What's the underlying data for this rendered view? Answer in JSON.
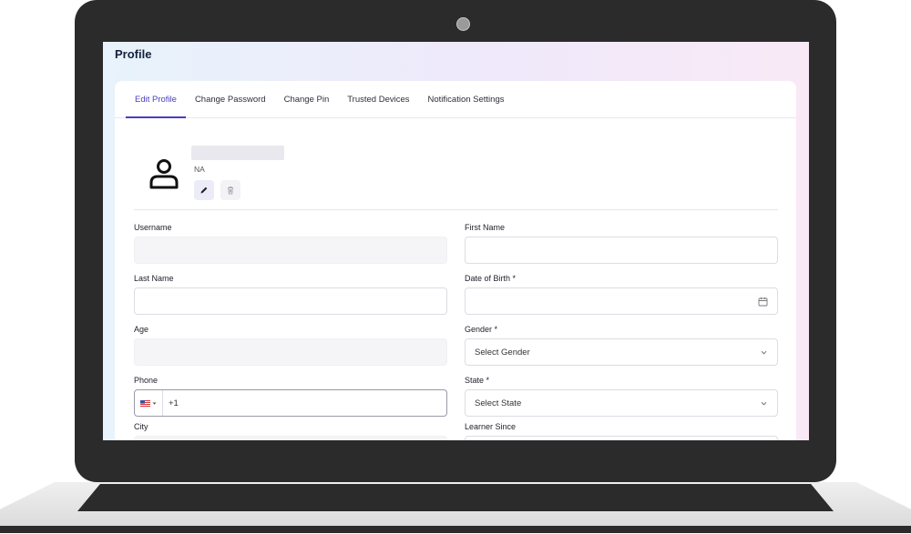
{
  "page": {
    "title": "Profile"
  },
  "tabs": [
    {
      "label": "Edit Profile",
      "active": true
    },
    {
      "label": "Change Password",
      "active": false
    },
    {
      "label": "Change Pin",
      "active": false
    },
    {
      "label": "Trusted Devices",
      "active": false
    },
    {
      "label": "Notification Settings",
      "active": false
    }
  ],
  "profile": {
    "role": "NA",
    "avatar_icon": "user-icon",
    "edit_icon": "pencil-icon",
    "delete_icon": "trash-icon"
  },
  "form": {
    "username": {
      "label": "Username",
      "value": ""
    },
    "first_name": {
      "label": "First Name",
      "value": ""
    },
    "last_name": {
      "label": "Last Name",
      "value": ""
    },
    "dob": {
      "label": "Date of Birth *",
      "value": "",
      "icon": "calendar-icon"
    },
    "age": {
      "label": "Age",
      "value": ""
    },
    "gender": {
      "label": "Gender *",
      "value": "Select Gender",
      "icon": "chevron-down-icon"
    },
    "phone": {
      "label": "Phone",
      "dial_code": "+1",
      "value": "",
      "flag_icon": "us-flag-icon"
    },
    "state": {
      "label": "State *",
      "value": "Select State",
      "icon": "chevron-down-icon"
    },
    "city": {
      "label": "City"
    },
    "learner_since": {
      "label": "Learner Since"
    }
  },
  "colors": {
    "accent": "#4b3cc0",
    "frame": "#2b2b2b",
    "title": "#14213d"
  }
}
